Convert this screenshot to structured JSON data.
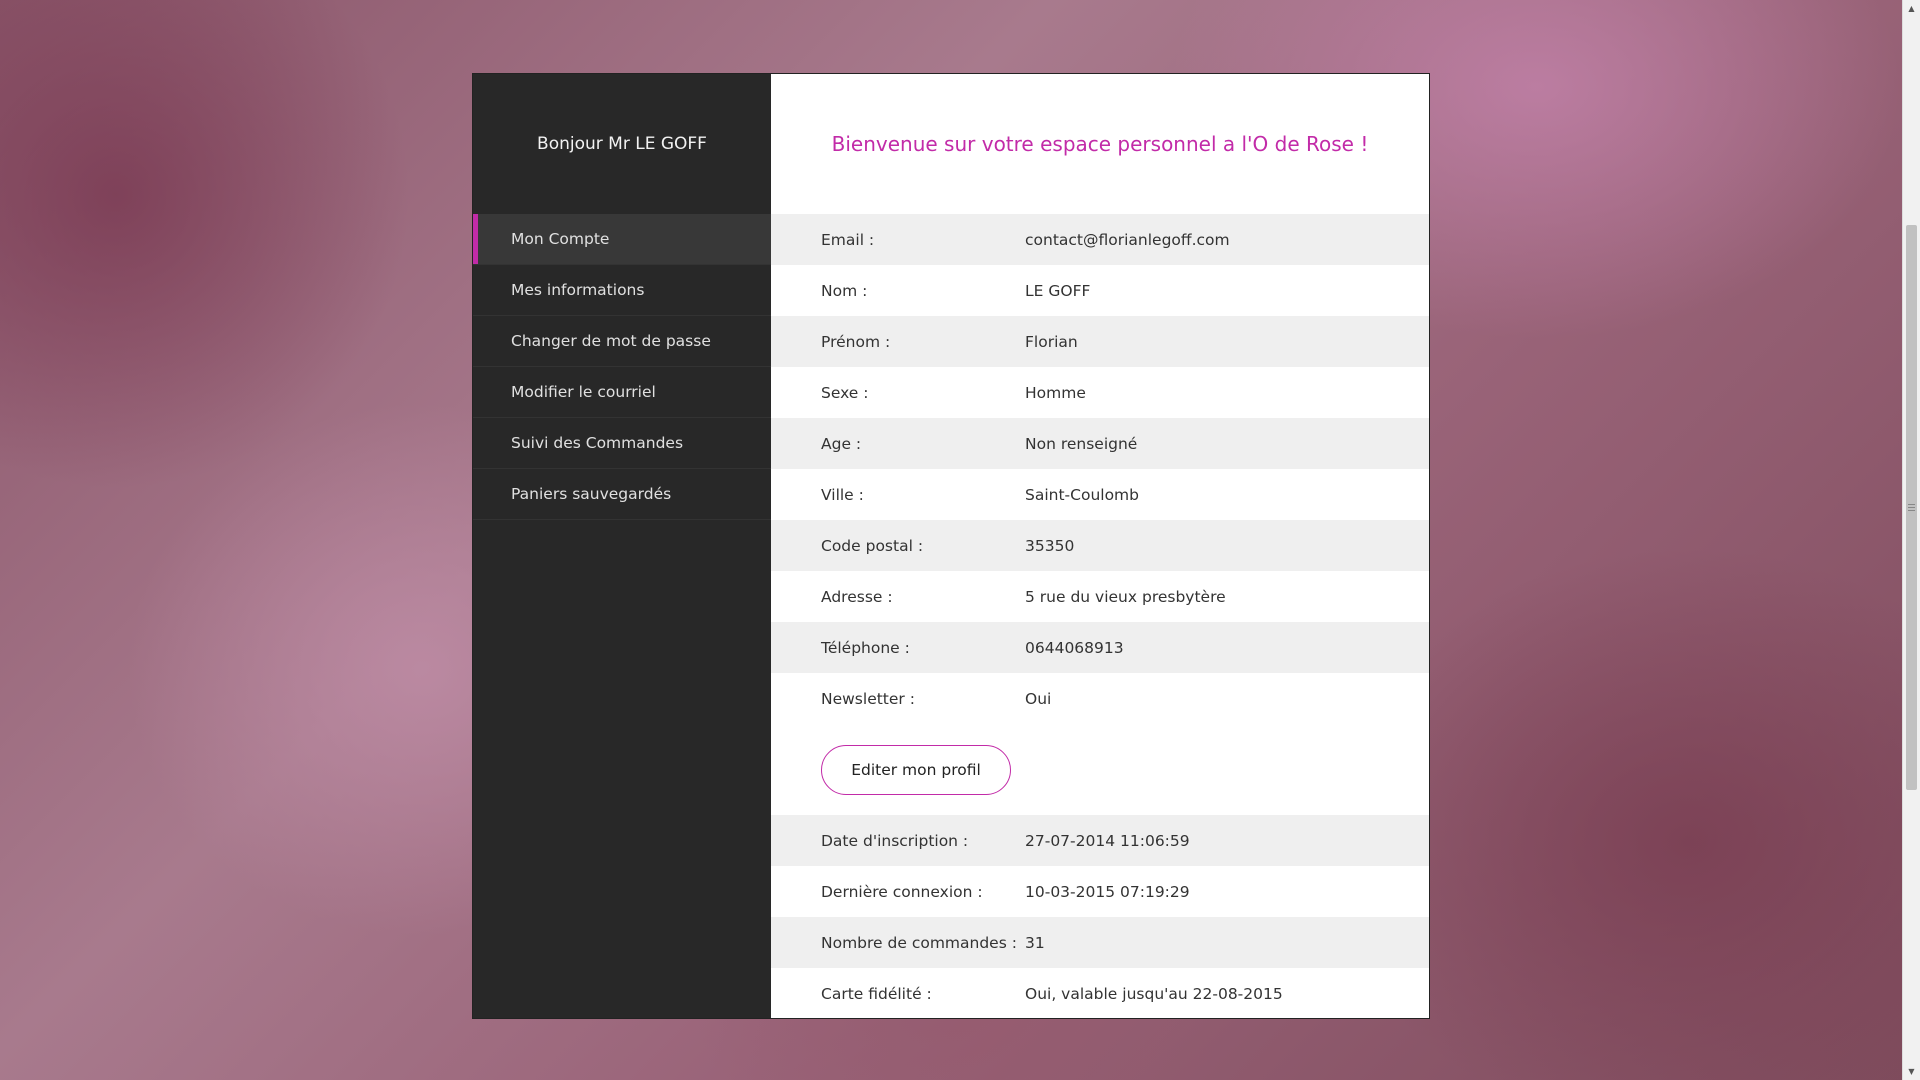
{
  "sidebar": {
    "greeting": "Bonjour Mr LE GOFF",
    "items": [
      {
        "label": "Mon Compte"
      },
      {
        "label": "Mes informations"
      },
      {
        "label": "Changer de mot de passe"
      },
      {
        "label": "Modifier le courriel"
      },
      {
        "label": "Suivi des Commandes"
      },
      {
        "label": "Paniers sauvegardés"
      }
    ]
  },
  "main": {
    "welcome": "Bienvenue sur votre espace personnel a l'O de Rose !",
    "profile": [
      {
        "label": "Email :",
        "value": "contact@florianlegoff.com"
      },
      {
        "label": "Nom :",
        "value": "LE GOFF"
      },
      {
        "label": "Prénom :",
        "value": "Florian"
      },
      {
        "label": "Sexe :",
        "value": "Homme"
      },
      {
        "label": "Age :",
        "value": "Non renseigné"
      },
      {
        "label": "Ville :",
        "value": "Saint-Coulomb"
      },
      {
        "label": "Code postal :",
        "value": "35350"
      },
      {
        "label": "Adresse :",
        "value": "5 rue du vieux presbytère"
      },
      {
        "label": "Téléphone :",
        "value": "0644068913"
      },
      {
        "label": "Newsletter :",
        "value": "Oui"
      }
    ],
    "edit_button": "Editer mon profil",
    "stats": [
      {
        "label": "Date d'inscription :",
        "value": "27-07-2014 11:06:59"
      },
      {
        "label": "Dernière connexion :",
        "value": "10-03-2015 07:19:29"
      },
      {
        "label": "Nombre de commandes :",
        "value": "31"
      },
      {
        "label": "Carte fidélité :",
        "value": "Oui, valable jusqu'au 22-08-2015"
      }
    ]
  },
  "colors": {
    "accent": "#c22ba8",
    "sidebar_bg": "#282828",
    "row_shade": "#efefef"
  },
  "icons": {
    "scroll_up": "chevron-up-icon",
    "scroll_down": "chevron-down-icon"
  }
}
